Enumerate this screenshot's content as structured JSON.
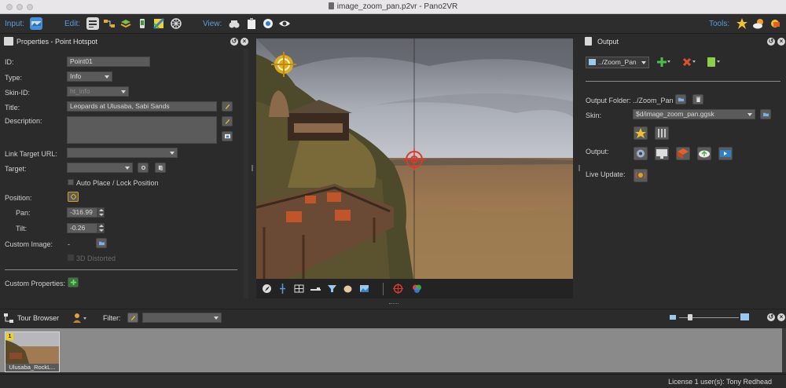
{
  "window": {
    "title": "image_zoom_pan.p2vr - Pano2VR"
  },
  "toolbar": {
    "input_label": "Input:",
    "edit_label": "Edit:",
    "view_label": "View:",
    "tools_label": "Tools:"
  },
  "properties": {
    "title": "Properties - Point Hotspot",
    "id_label": "ID:",
    "id_value": "Point01",
    "type_label": "Type:",
    "type_value": "Info",
    "skin_id_label": "Skin-ID:",
    "skin_id_placeholder": "ht_info",
    "title_label": "Title:",
    "title_value": "Leopards at Ulusaba, Sabi Sands",
    "description_label": "Description:",
    "description_value": "",
    "link_label": "Link Target URL:",
    "link_value": "",
    "target_label": "Target:",
    "target_value": "",
    "auto_place_label": "Auto Place / Lock Position",
    "position_label": "Position:",
    "pan_label": "Pan:",
    "pan_value": "-316.99",
    "tilt_label": "Tilt:",
    "tilt_value": "-0.26",
    "custom_image_label": "Custom Image:",
    "custom_image_value": "-",
    "distorted_label": "3D Distorted",
    "custom_props_label": "Custom Properties:"
  },
  "output": {
    "title": "Output",
    "preset_value": "../Zoom_Pan",
    "folder_label": "Output Folder:",
    "folder_value": "../Zoom_Pan",
    "skin_label": "Skin:",
    "skin_value": "$d/image_zoom_pan.ggsk",
    "output_label": "Output:",
    "live_update_label": "Live Update:"
  },
  "tour": {
    "title": "Tour Browser",
    "filter_label": "Filter:",
    "filter_value": "",
    "thumb_badge": "1",
    "thumb_label": "Ulusaba_RockL..."
  },
  "status": {
    "license_text": "License 1 user(s): Tony Redhead"
  },
  "colors": {
    "accent": "#5a9be0",
    "panel_bg": "#2b2b2b",
    "field_bg": "#5b5b5b",
    "hotspot_gold": "#e8b21e",
    "hotspot_red": "#d93a2a"
  }
}
